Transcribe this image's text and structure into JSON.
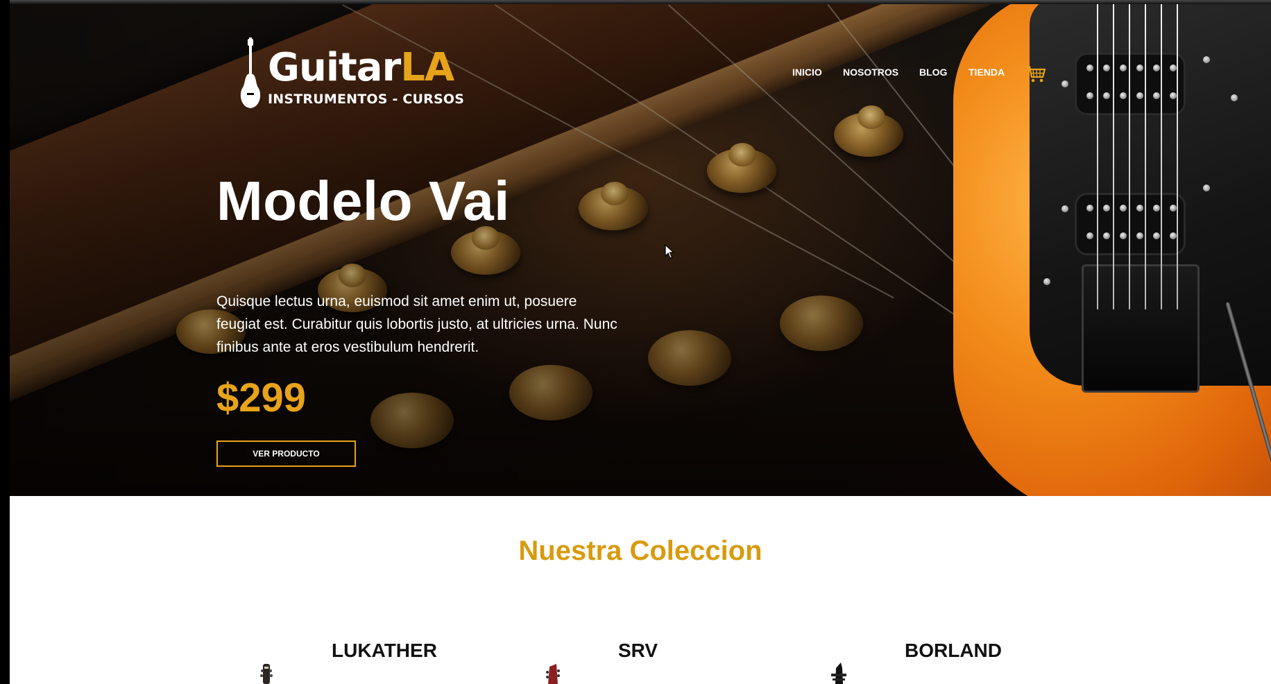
{
  "brand": {
    "name_main": "Guitar",
    "name_accent": "LA",
    "tagline": "INSTRUMENTOS - CURSOS"
  },
  "nav": {
    "items": [
      {
        "label": "INICIO"
      },
      {
        "label": "NOSOTROS"
      },
      {
        "label": "BLOG"
      },
      {
        "label": "TIENDA"
      }
    ],
    "cart_icon": "cart-icon"
  },
  "hero": {
    "title": "Modelo Vai",
    "description": "Quisque lectus urna, euismod sit amet enim ut, posuere feugiat est. Curabitur quis lobortis justo, at ultricies urna. Nunc finibus ante at eros vestibulum hendrerit.",
    "price": "$299",
    "button_label": "VER PRODUCTO"
  },
  "collection": {
    "title": "Nuestra Coleccion",
    "products": [
      {
        "name": "LUKATHER"
      },
      {
        "name": "SRV"
      },
      {
        "name": "BORLAND"
      }
    ]
  },
  "colors": {
    "accent": "#e7a41a",
    "section_title": "#d89b0e",
    "hero_text": "#ffffff"
  }
}
